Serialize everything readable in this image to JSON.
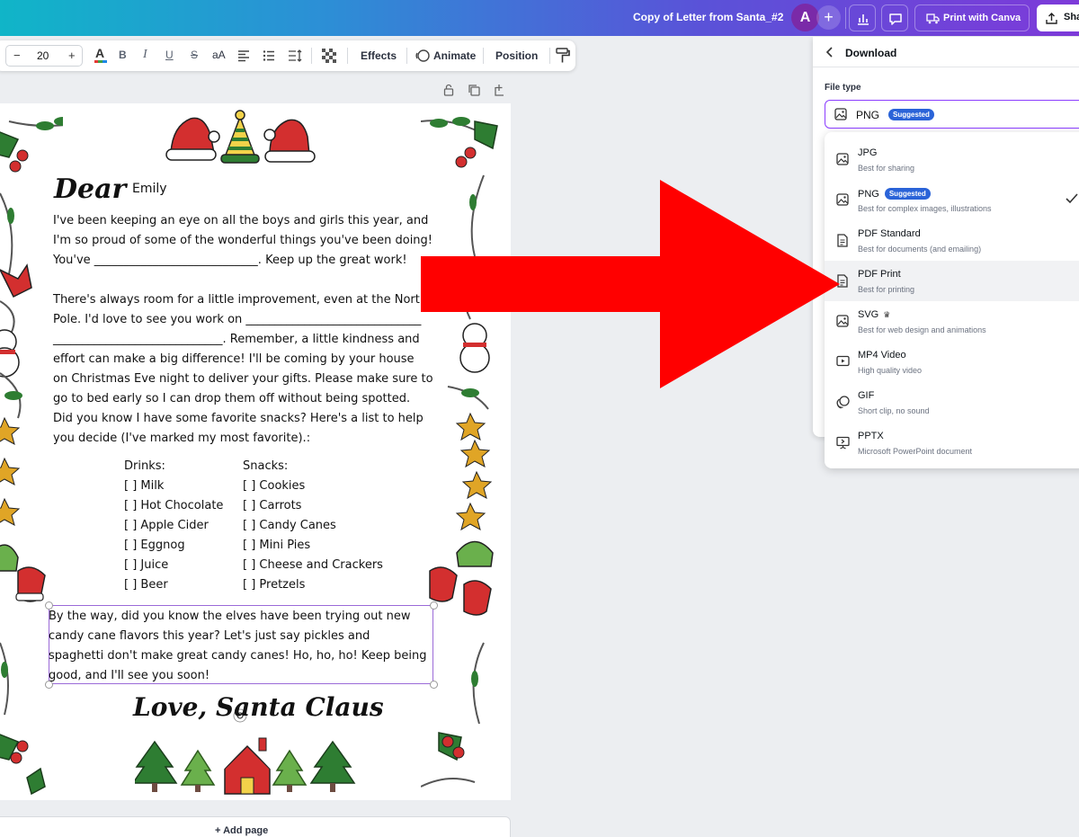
{
  "topbar": {
    "doc_title": "Copy of Letter from Santa_#2",
    "avatar_initial": "A",
    "plus": "+",
    "print_label": "Print with Canva",
    "share_label": "Sha"
  },
  "format_toolbar": {
    "font_size": "20",
    "minus": "−",
    "plus": "+",
    "bold": "B",
    "italic": "I",
    "underline": "U",
    "strike": "S",
    "case": "aA",
    "effects_label": "Effects",
    "animate_label": "Animate",
    "position_label": "Position"
  },
  "letter": {
    "dear": "Dear",
    "name": "Emily",
    "body_lines": [
      "I've been keeping an eye on all the boys and girls this year, and",
      "I'm so proud of some of the wonderful things you've been doing!",
      "You've ____________________________. Keep up the great work!",
      "",
      "There's always room for a little improvement, even at the North",
      "Pole. I'd love to see you work on ______________________________",
      "  _____________________________. Remember, a little kindness and",
      "effort can make a big difference! I'll be coming by your house",
      "on Christmas Eve night to deliver your gifts. Please make sure to",
      "go to bed early so I can drop them off without being spotted.",
      "Did you know I have some favorite snacks? Here's a list to help",
      "you decide (I've marked my most favorite).:"
    ],
    "drinks_heading": "Drinks:",
    "snacks_heading": "Snacks:",
    "drinks": [
      "[  ] Milk",
      "[  ] Hot Chocolate",
      "[  ] Apple Cider",
      "[  ] Eggnog",
      "[  ] Juice",
      "[  ] Beer"
    ],
    "snacks": [
      "[  ] Cookies",
      "[  ] Carrots",
      "[  ] Candy Canes",
      "[  ] Mini Pies",
      "[  ] Cheese and Crackers",
      "[  ] Pretzels"
    ],
    "ps_lines": [
      "By the way, did you know the elves have been trying out new",
      "candy cane flavors this year? Let's just say pickles and",
      "spaghetti don't make great candy canes! Ho, ho, ho! Keep being",
      "good, and I'll see you soon!"
    ],
    "signoff": "Love, Santa Claus"
  },
  "add_page_label": "+ Add page",
  "download_panel": {
    "title": "Download",
    "file_type_label": "File type",
    "selected_value": "PNG",
    "selected_badge": "Suggested",
    "options": [
      {
        "name": "JPG",
        "desc": "Best for sharing",
        "icon": "image-icon"
      },
      {
        "name": "PNG",
        "desc": "Best for complex images, illustrations",
        "badge": "Suggested",
        "icon": "image-icon",
        "checked": true
      },
      {
        "name": "PDF Standard",
        "desc": "Best for documents (and emailing)",
        "icon": "document-icon"
      },
      {
        "name": "PDF Print",
        "desc": "Best for printing",
        "icon": "document-icon",
        "hover": true
      },
      {
        "name": "SVG",
        "desc": "Best for web design and animations",
        "icon": "image-icon",
        "premium": "♛"
      },
      {
        "name": "MP4 Video",
        "desc": "High quality video",
        "icon": "video-icon"
      },
      {
        "name": "GIF",
        "desc": "Short clip, no sound",
        "icon": "gif-icon"
      },
      {
        "name": "PPTX",
        "desc": "Microsoft PowerPoint document",
        "icon": "presentation-icon"
      }
    ]
  },
  "colors": {
    "accent": "#8b3dff",
    "badge": "#2a63d8",
    "arrow": "#ff0000",
    "holly_green": "#2e7d32",
    "berry_red": "#d32f2f",
    "star_gold": "#e0a526"
  }
}
